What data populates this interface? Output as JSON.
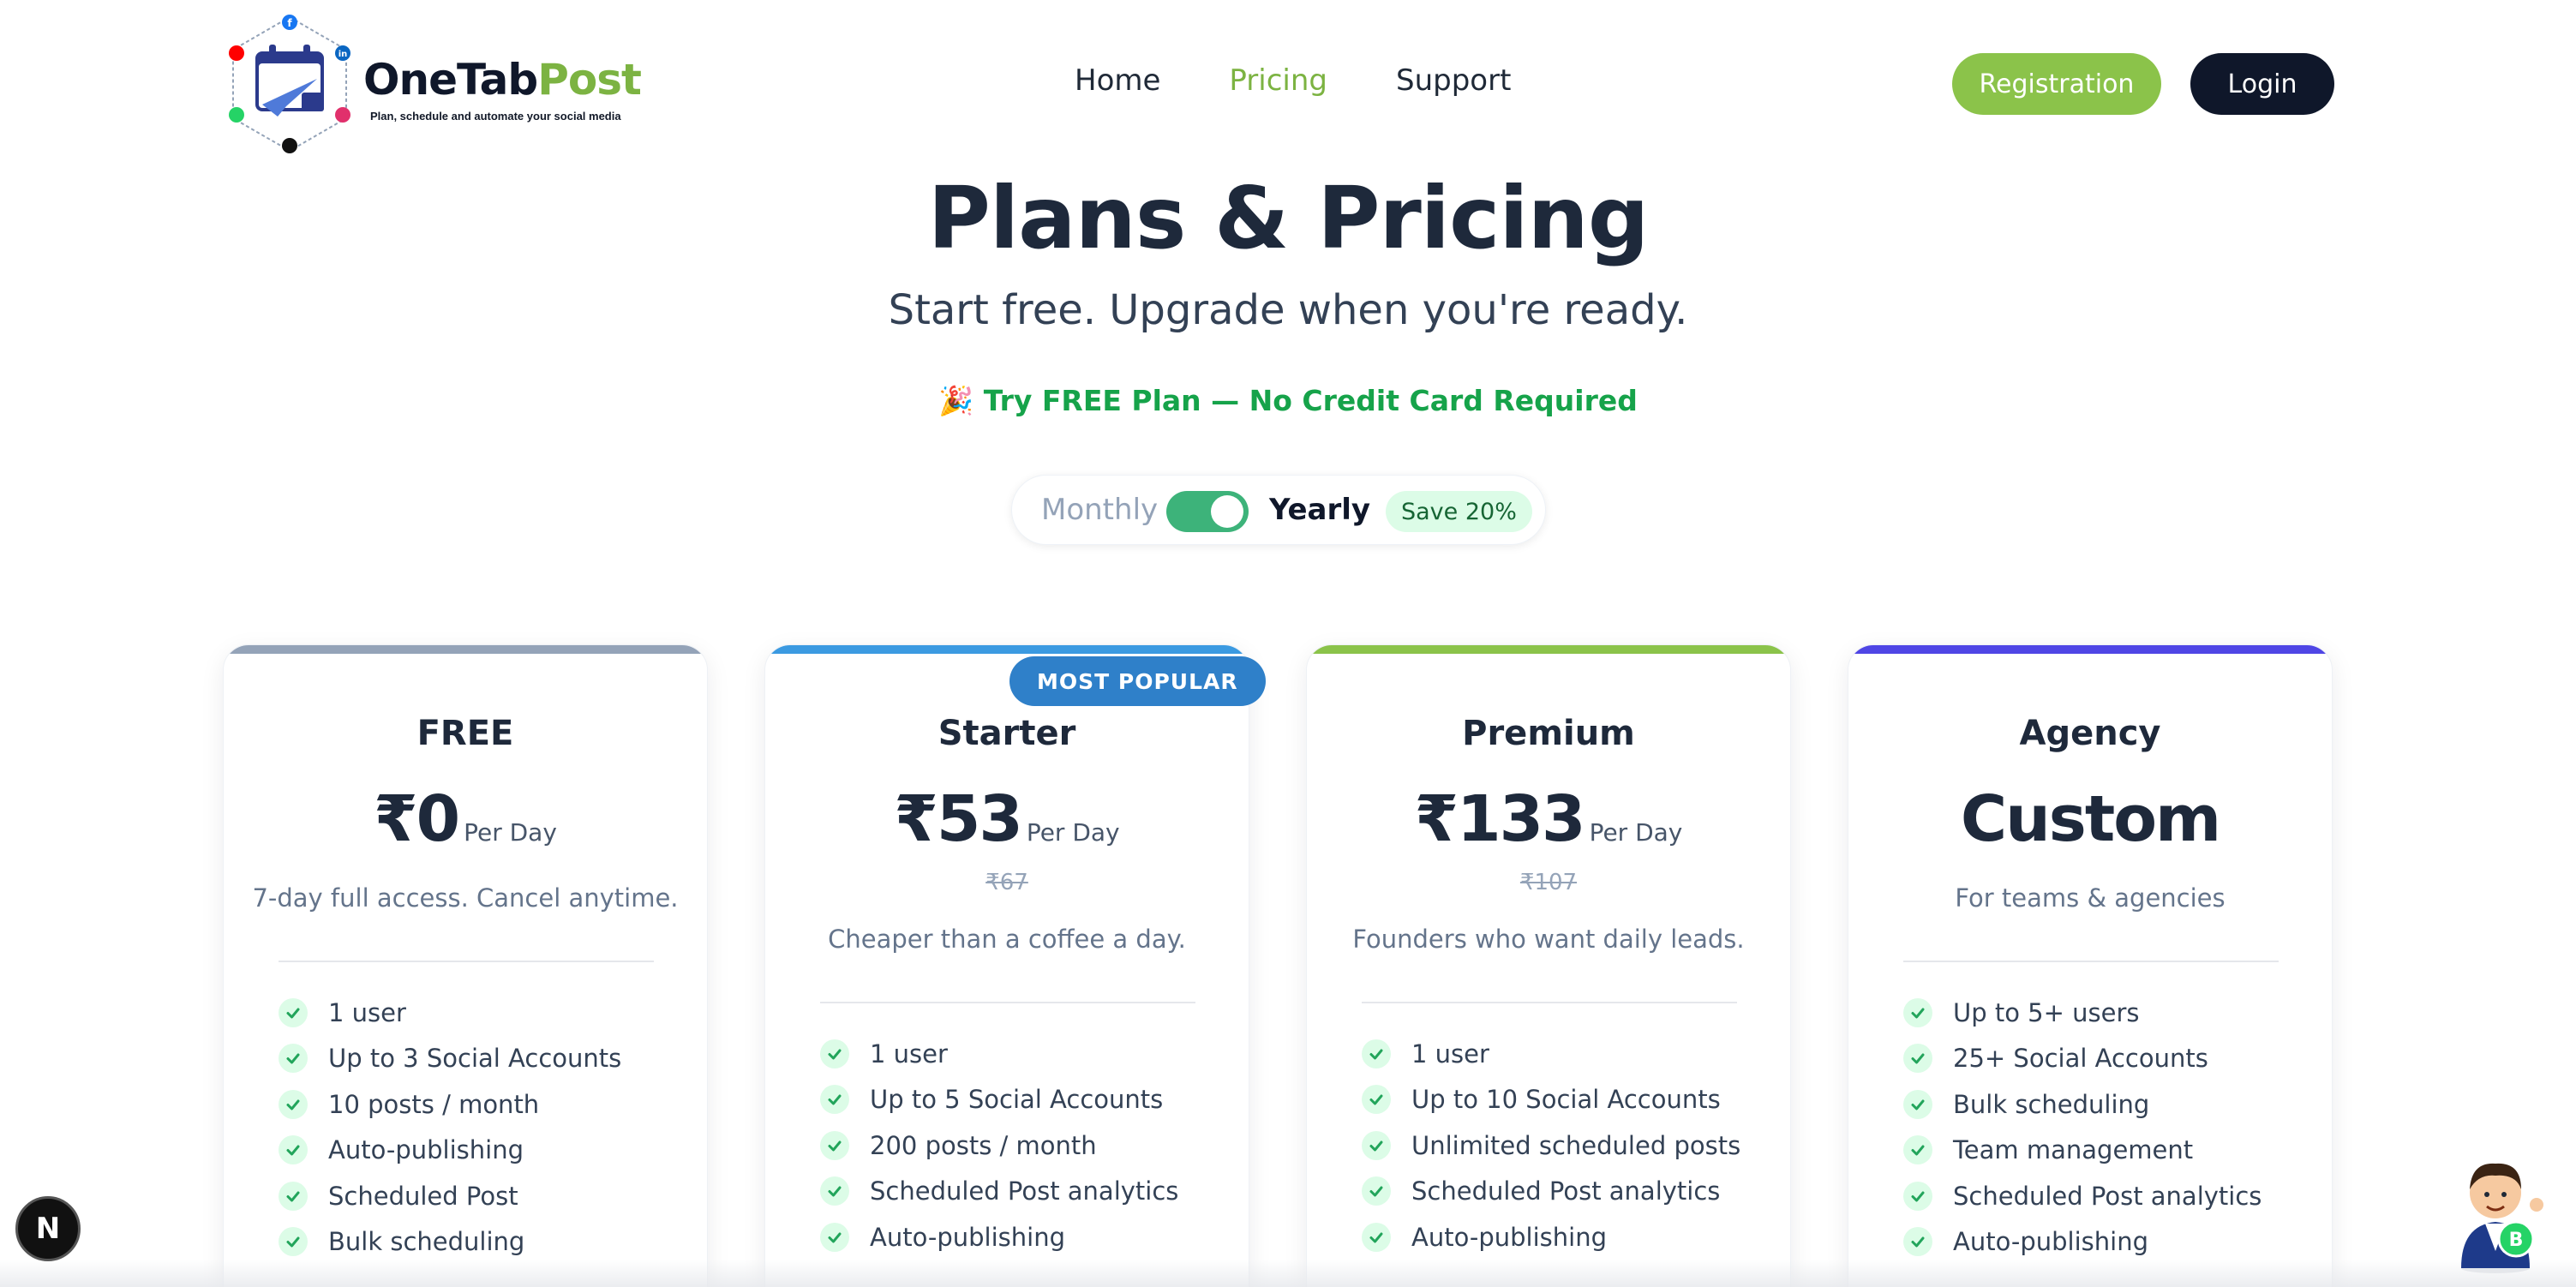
{
  "brand": {
    "name_part1": "OneTab",
    "name_part2": "Post",
    "tagline": "Plan, schedule and automate your social media",
    "accent": "#7cb342",
    "dark": "#0f172a"
  },
  "nav": {
    "items": [
      {
        "label": "Home",
        "active": false
      },
      {
        "label": "Pricing",
        "active": true
      },
      {
        "label": "Support",
        "active": false
      }
    ],
    "registration_label": "Registration",
    "login_label": "Login"
  },
  "hero": {
    "title": "Plans & Pricing",
    "subtitle": "Start free. Upgrade when you're ready.",
    "promo_emoji": "🎉",
    "promo_text": "Try FREE Plan — No Credit Card Required"
  },
  "billing_toggle": {
    "monthly_label": "Monthly",
    "yearly_label": "Yearly",
    "selected": "Yearly",
    "save_badge": "Save 20%"
  },
  "plans": [
    {
      "name": "FREE",
      "price": "₹0",
      "period": "Per Day",
      "old_price": "",
      "description": "7-day full access. Cancel anytime.",
      "accent": "#94a3b8",
      "features": [
        "1 user",
        "Up to 3 Social Accounts",
        "10 posts / month",
        "Auto-publishing",
        "Scheduled Post",
        "Bulk scheduling"
      ]
    },
    {
      "name": "Starter",
      "badge": "MOST POPULAR",
      "price": "₹53",
      "period": "Per Day",
      "old_price": "₹67",
      "description": "Cheaper than a coffee a day.",
      "accent": "#3b9ae1",
      "features": [
        "1 user",
        "Up to 5 Social Accounts",
        "200 posts / month",
        "Scheduled Post analytics",
        "Auto-publishing"
      ]
    },
    {
      "name": "Premium",
      "price": "₹133",
      "period": "Per Day",
      "old_price": "₹107",
      "description": "Founders who want daily leads.",
      "accent": "#8bc34a",
      "features": [
        "1 user",
        "Up to 10 Social Accounts",
        "Unlimited scheduled posts",
        "Scheduled Post analytics",
        "Auto-publishing"
      ]
    },
    {
      "name": "Agency",
      "price": "Custom",
      "period": "",
      "old_price": "",
      "description": "For teams & agencies",
      "accent": "#4f46e5",
      "features": [
        "Up to 5+ users",
        "25+ Social Accounts",
        "Bulk scheduling",
        "Team management",
        "Scheduled Post analytics",
        "Auto-publishing"
      ]
    }
  ],
  "floating": {
    "dev_badge_letter": "N",
    "whatsapp_letter": "B"
  }
}
